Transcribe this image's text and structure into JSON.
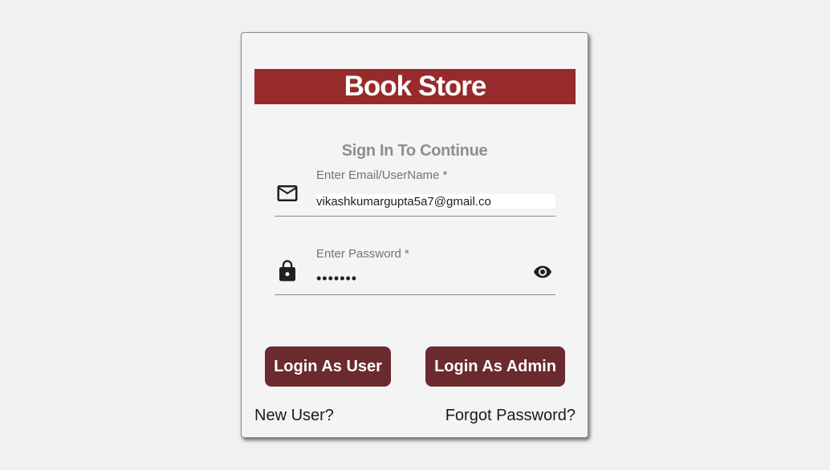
{
  "app": {
    "title": "Book Store"
  },
  "form": {
    "subtitle": "Sign In To Continue",
    "email": {
      "label": "Enter Email/UserName *",
      "value": "vikashkumargupta5a7@gmail.co",
      "icon": "mail-icon"
    },
    "password": {
      "label": "Enter Password *",
      "value": "•••••••",
      "icon": "lock-icon",
      "toggle_icon": "eye-icon"
    }
  },
  "buttons": {
    "login_user": "Login As User",
    "login_admin": "Login As Admin"
  },
  "links": {
    "new_user": "New User?",
    "forgot_password": "Forgot Password?"
  },
  "colors": {
    "banner": "#972b2b",
    "button": "#6a2a2e"
  }
}
